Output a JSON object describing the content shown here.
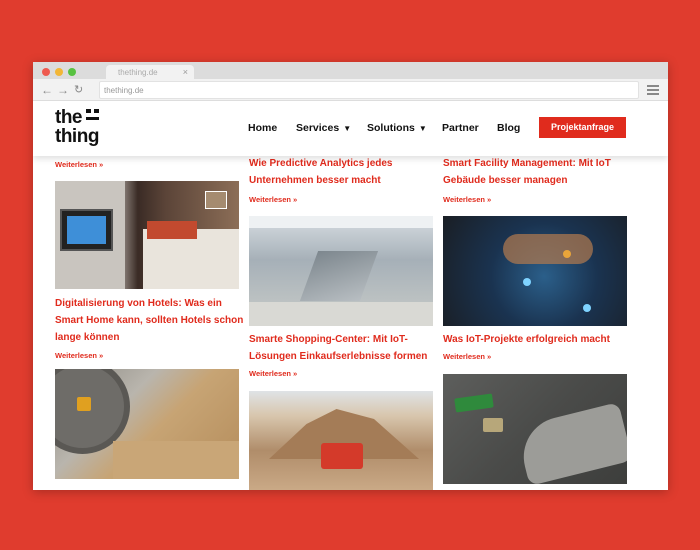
{
  "browser": {
    "tab_title": "thething.de",
    "url": "thething.de"
  },
  "site": {
    "logo_line1": "the",
    "logo_line2": "thing",
    "nav": {
      "home": "Home",
      "services": "Services",
      "solutions": "Solutions",
      "partner": "Partner",
      "blog": "Blog",
      "cta": "Projektanfrage"
    }
  },
  "articles": {
    "read_more": "Weiterlesen »",
    "col1_top_more": "Weiterlesen »",
    "a1": "Wie Predictive Analytics jedes Unternehmen besser macht",
    "a2": "Smart Facility Management: Mit IoT Gebäude besser managen",
    "a3": "Digitalisierung von Hotels: Was ein Smart Home kann, sollten Hotels schon lange können",
    "a4": "Smarte Shopping-Center: Mit IoT-Lösungen Einkaufserlebnisse formen",
    "a5": "Was IoT-Projekte erfolgreich macht"
  },
  "colors": {
    "accent": "#e02b1d",
    "background": "#e03c2e"
  },
  "icons": [
    "back-arrow-icon",
    "forward-arrow-icon",
    "reload-icon",
    "hamburger-menu-icon",
    "chevron-down-icon",
    "close-icon"
  ]
}
